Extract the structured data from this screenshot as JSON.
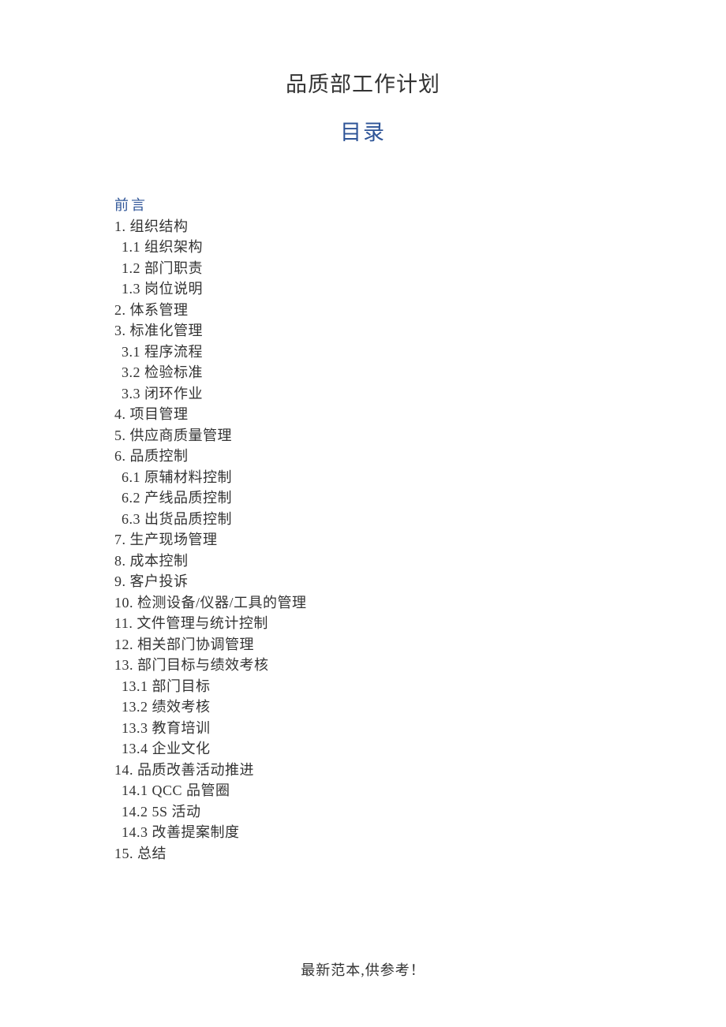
{
  "title": "品质部工作计划",
  "subtitle": "目录",
  "preface": "前言",
  "toc": [
    {
      "level": 1,
      "text": "1.  组织结构"
    },
    {
      "level": 2,
      "text": "1.1 组织架构"
    },
    {
      "level": 2,
      "text": "1.2 部门职责"
    },
    {
      "level": 2,
      "text": "1.3 岗位说明"
    },
    {
      "level": 1,
      "text": "2.  体系管理"
    },
    {
      "level": 1,
      "text": "3.  标准化管理"
    },
    {
      "level": 2,
      "text": "3.1 程序流程"
    },
    {
      "level": 2,
      "text": "3.2 检验标准"
    },
    {
      "level": 2,
      "text": "3.3 闭环作业"
    },
    {
      "level": 1,
      "text": "4.  项目管理"
    },
    {
      "level": 1,
      "text": "5.  供应商质量管理"
    },
    {
      "level": 1,
      "text": "6.  品质控制"
    },
    {
      "level": 2,
      "text": "6.1 原辅材料控制"
    },
    {
      "level": 2,
      "text": "6.2 产线品质控制"
    },
    {
      "level": 2,
      "text": "6.3 出货品质控制"
    },
    {
      "level": 1,
      "text": "7.  生产现场管理"
    },
    {
      "level": 1,
      "text": "8.  成本控制"
    },
    {
      "level": 1,
      "text": "9.  客户投诉"
    },
    {
      "level": 1,
      "text": "10.  检测设备/仪器/工具的管理"
    },
    {
      "level": 1,
      "text": "11.  文件管理与统计控制"
    },
    {
      "level": 1,
      "text": "12.  相关部门协调管理"
    },
    {
      "level": 1,
      "text": "13.  部门目标与绩效考核"
    },
    {
      "level": 2,
      "text": "13.1 部门目标"
    },
    {
      "level": 2,
      "text": "13.2 绩效考核"
    },
    {
      "level": 2,
      "text": "13.3 教育培训"
    },
    {
      "level": 2,
      "text": "13.4 企业文化"
    },
    {
      "level": 1,
      "text": "14.  品质改善活动推进"
    },
    {
      "level": 2,
      "text": "14.1 QCC 品管圈"
    },
    {
      "level": 2,
      "text": "14.2 5S 活动"
    },
    {
      "level": 2,
      "text": "14.3 改善提案制度"
    },
    {
      "level": 1,
      "text": "15.  总结"
    }
  ],
  "footer": "最新范本,供参考！"
}
